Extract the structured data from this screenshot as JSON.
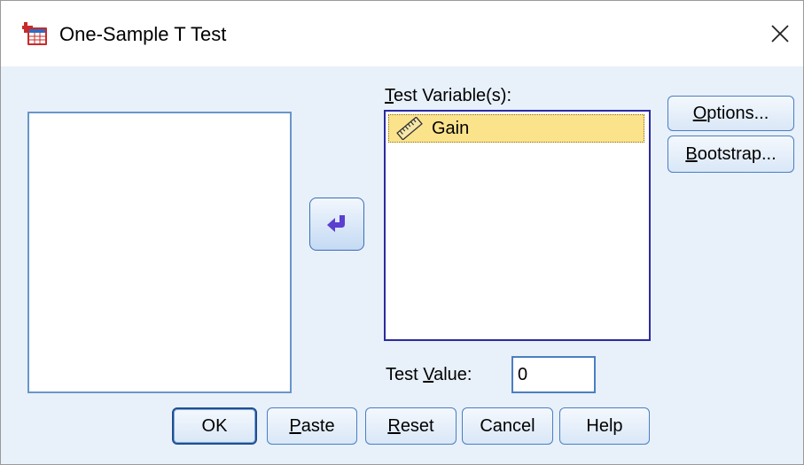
{
  "window": {
    "title": "One-Sample T Test",
    "icon": "spss-table-icon"
  },
  "test_variables": {
    "label_prefix": "T",
    "label_rest": "est Variable(s):",
    "items": [
      {
        "name": "Gain",
        "icon": "scale-ruler-icon"
      }
    ]
  },
  "test_value": {
    "label_before": "Test ",
    "label_underline": "V",
    "label_after": "alue:",
    "value": "0"
  },
  "side_buttons": {
    "options": {
      "ul": "O",
      "rest": "ptions..."
    },
    "bootstrap": {
      "ul": "B",
      "rest": "ootstrap..."
    }
  },
  "bottom_buttons": {
    "ok": "OK",
    "paste": {
      "ul": "P",
      "rest": "aste"
    },
    "reset": {
      "ul": "R",
      "rest": "eset"
    },
    "cancel": "Cancel",
    "help": "Help"
  },
  "colors": {
    "dialog_bg": "#e8f0fa",
    "selected_item_bg": "#fbe38c",
    "button_border": "#4a7fc0"
  }
}
